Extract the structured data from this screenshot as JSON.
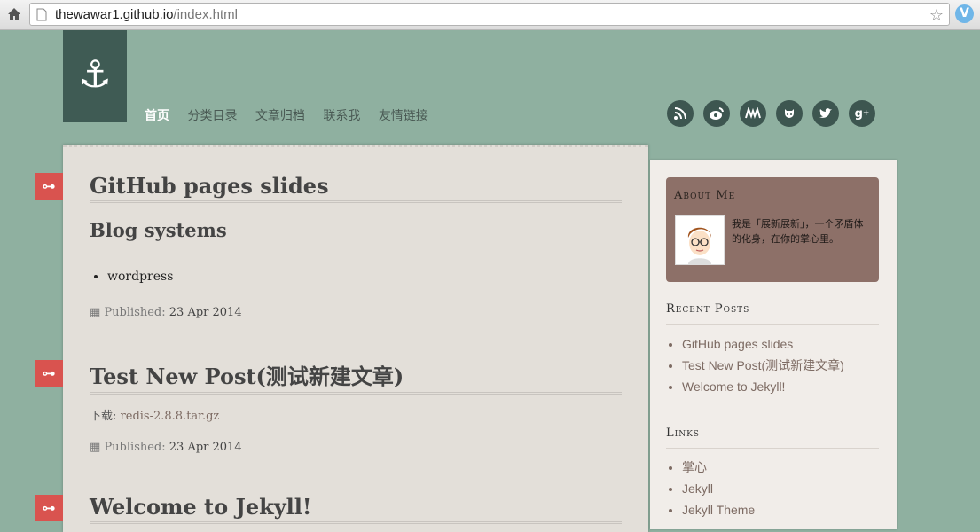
{
  "browser": {
    "url_host": "thewawar1.github.io",
    "url_path": "/index.html"
  },
  "nav": {
    "items": [
      "首页",
      "分类目录",
      "文章归档",
      "联系我",
      "友情链接"
    ]
  },
  "social_icons": [
    "rss-icon",
    "weibo-icon",
    "douban-icon",
    "github-icon",
    "twitter-icon",
    "google-plus-icon"
  ],
  "posts": [
    {
      "title": "GitHub pages slides",
      "subheading": "Blog systems",
      "bullets": [
        "wordpress"
      ],
      "published_label": "Published:",
      "published_date": "23 Apr 2014"
    },
    {
      "title": "Test New Post(测试新建文章)",
      "download_label": "下载:",
      "download_link": "redis-2.8.8.tar.gz",
      "published_label": "Published:",
      "published_date": "23 Apr 2014"
    },
    {
      "title": "Welcome to Jekyll!"
    }
  ],
  "sidebar": {
    "about": {
      "title": "About Me",
      "text": "我是「展新展新」，一个矛盾体的化身，在你的掌心里。"
    },
    "recent": {
      "title": "Recent Posts",
      "items": [
        "GitHub pages slides",
        "Test New Post(测试新建文章)",
        "Welcome to Jekyll!"
      ]
    },
    "links": {
      "title": "Links",
      "items": [
        "掌心",
        "Jekyll",
        "Jekyll Theme"
      ]
    }
  },
  "colors": {
    "background": "#8fb0a0",
    "accent_red": "#d9534f",
    "about_bg": "#8d7068",
    "link": "#7d6b63"
  }
}
